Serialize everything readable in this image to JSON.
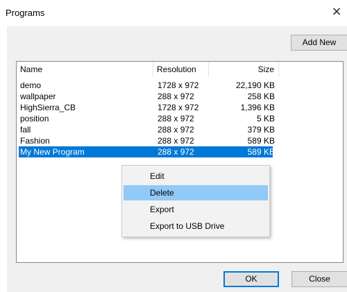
{
  "window": {
    "title": "Programs",
    "close_glyph": "×"
  },
  "toolbar": {
    "add_new_label": "Add New"
  },
  "list": {
    "columns": [
      "Name",
      "Resolution",
      "Size"
    ],
    "rows": [
      {
        "name": "demo",
        "resolution": "1728 x 972",
        "size": "22,190 KB"
      },
      {
        "name": "wallpaper",
        "resolution": "288 x 972",
        "size": "258 KB"
      },
      {
        "name": "HighSierra_CB",
        "resolution": "1728 x 972",
        "size": "1,396 KB"
      },
      {
        "name": "position",
        "resolution": "288 x 972",
        "size": "5 KB"
      },
      {
        "name": "fall",
        "resolution": "288 x 972",
        "size": "379 KB"
      },
      {
        "name": "Fashion",
        "resolution": "288 x 972",
        "size": "589 KB"
      },
      {
        "name": "My New Program",
        "resolution": "288 x 972",
        "size": "589 KB",
        "selected": true
      }
    ]
  },
  "context_menu": {
    "items": [
      "Edit",
      "Delete",
      "Export",
      "Export to USB Drive"
    ],
    "highlighted": "Delete"
  },
  "footer": {
    "ok_label": "OK",
    "close_label": "Close"
  },
  "colors": {
    "selection": "#0078d7",
    "menu_hover": "#91c9f7",
    "dialog_bg": "#f0f0f0"
  }
}
